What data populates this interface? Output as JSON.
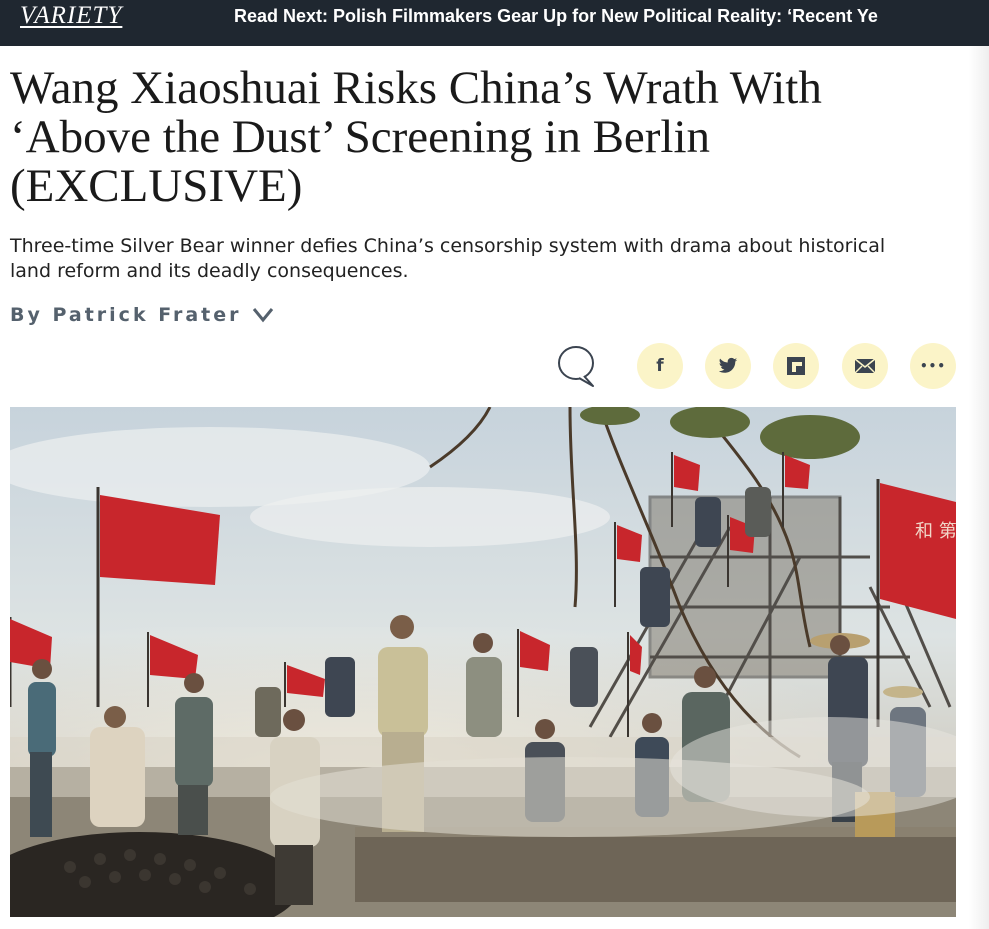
{
  "header": {
    "logo": "VARIETY",
    "read_next": "Read Next: Polish Filmmakers Gear Up for New Political Reality: ‘Recent Ye"
  },
  "article": {
    "title_lines": [
      "Wang Xiaoshuai Risks China’s Wrath With",
      "‘Above the Dust’ Screening in Berlin",
      "(EXCLUSIVE)"
    ],
    "dek_lines": [
      "Three-time Silver Bear winner defies China’s censorship system with drama about historical",
      "land reform and its deadly consequences."
    ],
    "byline": "By Patrick Frater"
  },
  "share": {
    "buttons": [
      {
        "name": "comment-icon",
        "glyph": ""
      },
      {
        "name": "facebook-icon",
        "glyph": "f"
      },
      {
        "name": "twitter-icon",
        "glyph": ""
      },
      {
        "name": "flipboard-icon",
        "glyph": ""
      },
      {
        "name": "email-icon",
        "glyph": ""
      },
      {
        "name": "more-icon",
        "glyph": "•••"
      }
    ],
    "button_bg": "#fbf4c8"
  },
  "hero_image": {
    "flag_text": "和 第"
  },
  "colors": {
    "topbar": "#1f2730",
    "flag_red": "#c8262c",
    "byline": "#55616d"
  }
}
